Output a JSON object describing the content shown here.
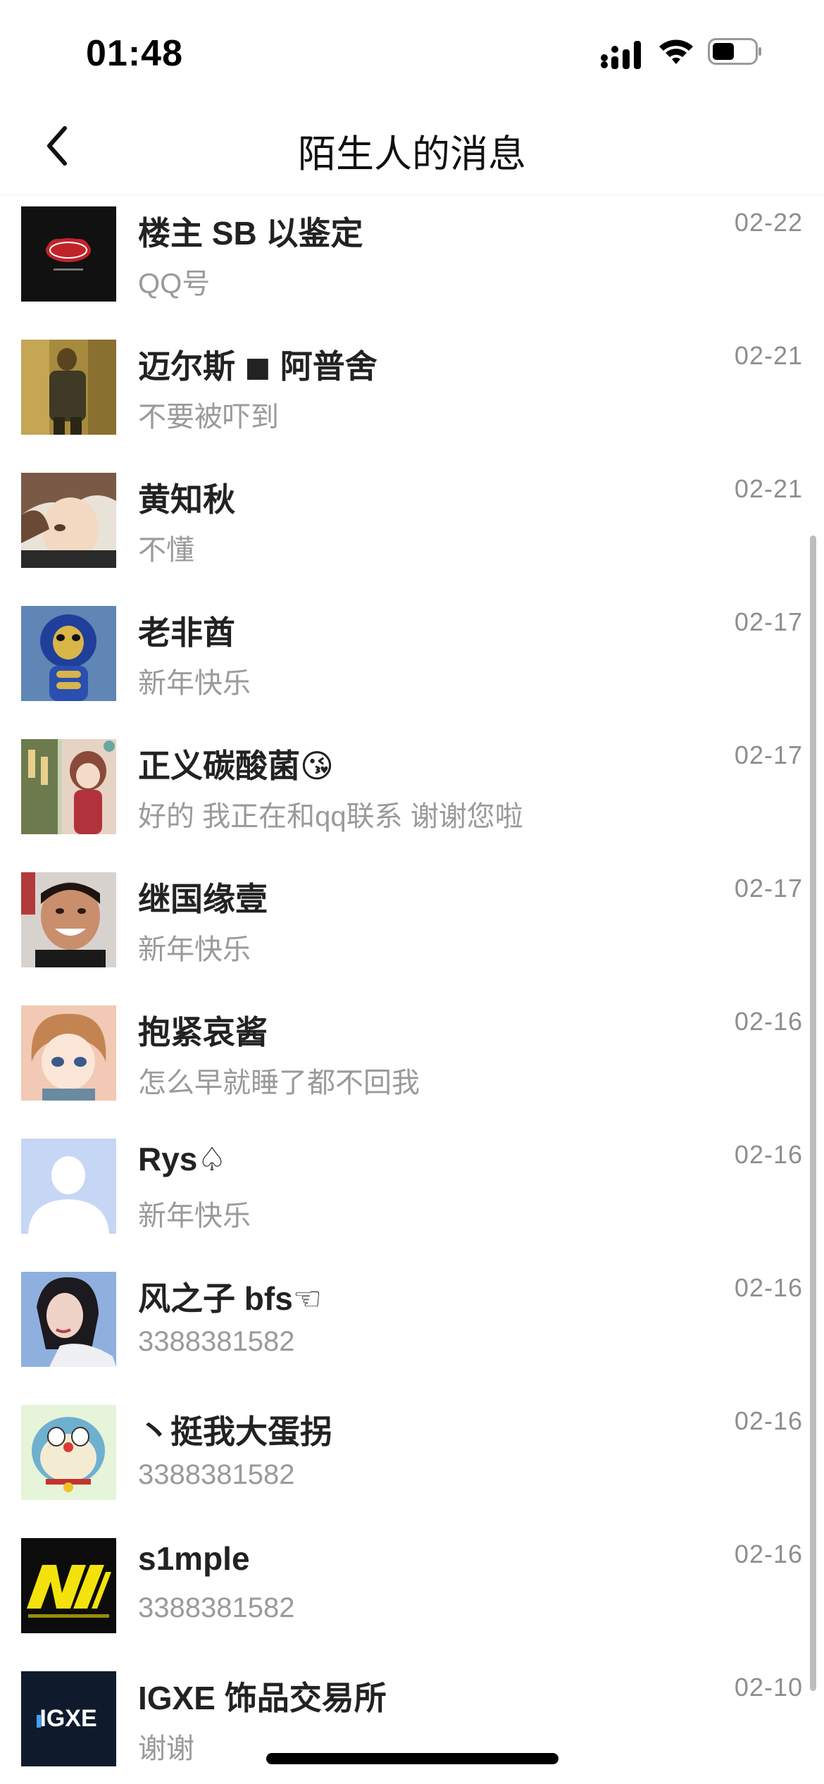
{
  "status_bar": {
    "time": "01:48",
    "icons": [
      "cellular-signal-icon",
      "wifi-icon",
      "battery-icon"
    ]
  },
  "nav": {
    "back_icon": "chevron-left-icon",
    "title": "陌生人的消息"
  },
  "messages": [
    {
      "name": "楼主 SB 以鉴定",
      "preview": "QQ号",
      "date": "02-22",
      "avatar": "akatsuki-cloud-avatar"
    },
    {
      "name": "迈尔斯 ◼ 阿普舍",
      "preview": "不要被吓到",
      "date": "02-21",
      "avatar": "golden-figure-avatar"
    },
    {
      "name": "黄知秋",
      "preview": "不懂",
      "date": "02-21",
      "avatar": "anime-boy-avatar"
    },
    {
      "name": "老非酋",
      "preview": "新年快乐",
      "date": "02-17",
      "avatar": "cobra-robot-avatar"
    },
    {
      "name": "正义碳酸菌😘",
      "preview": "好的 我正在和qq联系 谢谢您啦",
      "date": "02-17",
      "avatar": "anime-girl-avatar"
    },
    {
      "name": "继国缘壹",
      "preview": "新年快乐",
      "date": "02-17",
      "avatar": "smiling-boy-avatar"
    },
    {
      "name": "抱紧哀酱",
      "preview": "怎么早就睡了都不回我",
      "date": "02-16",
      "avatar": "anime-brown-hair-avatar"
    },
    {
      "name": "Rys♤",
      "preview": "新年快乐",
      "date": "02-16",
      "avatar": "default-person-avatar"
    },
    {
      "name": "风之子 bfs☜",
      "preview": "3388381582",
      "date": "02-16",
      "avatar": "woman-portrait-avatar"
    },
    {
      "name": "丶挺我大蛋拐",
      "preview": "3388381582",
      "date": "02-16",
      "avatar": "doraemon-cat-avatar"
    },
    {
      "name": "s1mple",
      "preview": "3388381582",
      "date": "02-16",
      "avatar": "navi-logo-avatar"
    },
    {
      "name": "IGXE 饰品交易所",
      "preview": "谢谢",
      "date": "02-10",
      "avatar": "igxe-logo-avatar",
      "avatar_text": "IGXE"
    }
  ],
  "colors": {
    "background": "#ffffff",
    "name_text": "#222222",
    "preview_text": "#9a9a9a",
    "date_text": "#8e8e8e"
  }
}
